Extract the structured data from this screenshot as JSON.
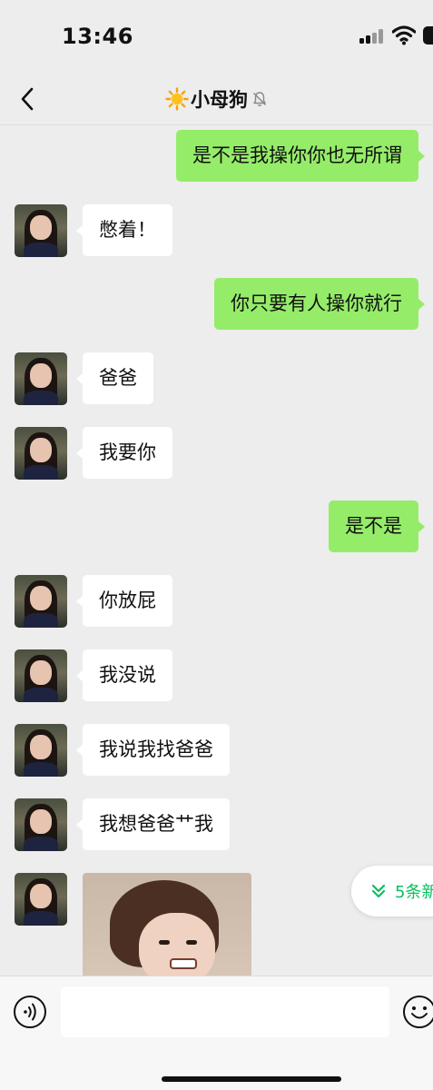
{
  "status_bar": {
    "time": "13:46"
  },
  "nav": {
    "title": "小母狗",
    "title_icon": "sun-icon",
    "mute_icon": "bell-muted-icon"
  },
  "messages": [
    {
      "side": "out",
      "text": "是不是我操你你也无所谓"
    },
    {
      "side": "in",
      "text": "憋着！"
    },
    {
      "side": "out",
      "text": "你只要有人操你就行"
    },
    {
      "side": "in",
      "text": "爸爸"
    },
    {
      "side": "in",
      "text": "我要你"
    },
    {
      "side": "out",
      "text": "是不是"
    },
    {
      "side": "in",
      "text": "你放屁"
    },
    {
      "side": "in",
      "text": "我没说"
    },
    {
      "side": "in",
      "text": "我说我找爸爸"
    },
    {
      "side": "in",
      "text": "我想爸爸艹我"
    },
    {
      "side": "in",
      "type": "sticker",
      "icon": "sticker-image"
    }
  ],
  "new_messages_pill": {
    "label": "5条新"
  },
  "input_bar": {
    "value": "",
    "left_icon": "voice-icon",
    "right_icon": "emoji-icon"
  },
  "colors": {
    "outgoing_bubble": "#95ec69",
    "incoming_bubble": "#ffffff",
    "background": "#ededed",
    "accent": "#07c160"
  }
}
